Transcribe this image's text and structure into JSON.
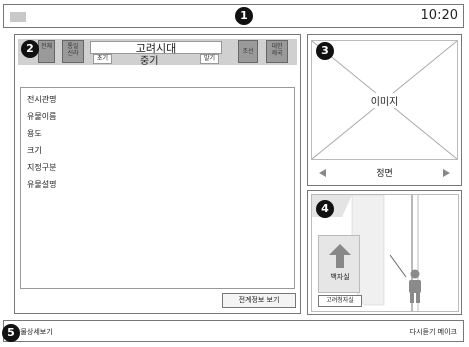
{
  "topbar": {
    "menu_icon": "menu-icon",
    "time": "10:20"
  },
  "badges": {
    "b1": "1",
    "b2": "2",
    "b3": "3",
    "b4": "4",
    "b5": "5"
  },
  "left": {
    "btn_a": "전체",
    "btn_b": "통일\n신라",
    "title": "고려시대",
    "btn_c": "조선",
    "btn_d": "대한\n제국",
    "sub_left": "초기",
    "sub_mid": "중기",
    "sub_right": "말기",
    "items": [
      "전시관명",
      "유물이름",
      "용도",
      "크기",
      "지정구분",
      "유물설명"
    ],
    "detail_button": "전계정보 보기"
  },
  "image_panel": {
    "label": "이미지",
    "caption": "정면",
    "prev_icon": "left-triangle-icon",
    "next_icon": "right-triangle-icon"
  },
  "map_panel": {
    "exhibit_label": "백자실",
    "room_label": "고려청자실",
    "arrow_icon": "up-arrow-icon",
    "person_icon": "person-icon"
  },
  "bottombar": {
    "left_text": "유물상세보기",
    "right_text": "다시듣기 메이크"
  }
}
